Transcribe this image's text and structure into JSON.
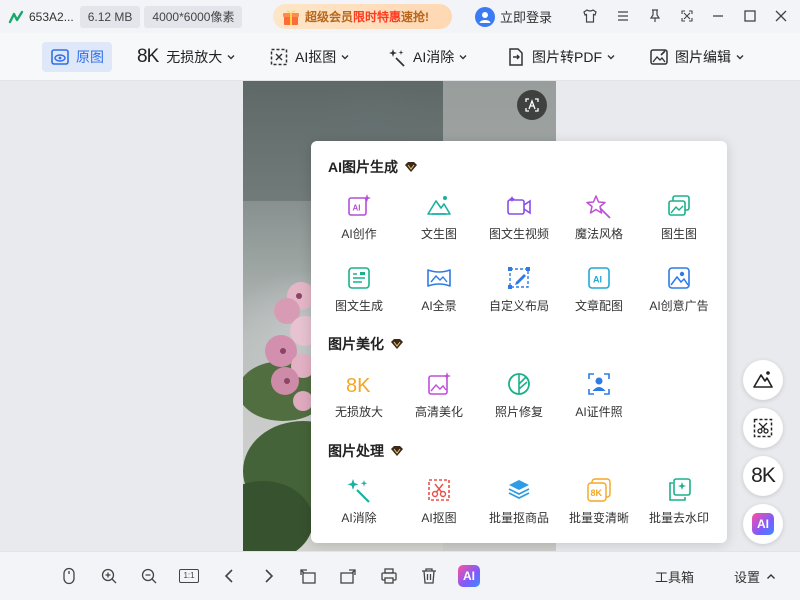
{
  "titlebar": {
    "filename": "653A2...",
    "filesize": "6.12 MB",
    "dimensions": "4000*6000像素",
    "promo": {
      "prefix": "超级会员",
      "hot": "限时特惠",
      "suffix": "速抢!"
    },
    "login_label": "立即登录"
  },
  "toolbar": {
    "original": "原图",
    "upscale_badge": "8K",
    "upscale": "无损放大",
    "cutout": "AI抠图",
    "erase": "AI消除",
    "to_pdf": "图片转PDF",
    "edit": "图片编辑"
  },
  "popup": {
    "sections": [
      {
        "title": "AI图片生成",
        "tools": [
          {
            "label": "AI创作",
            "icon": "ai-create-icon",
            "color": "#b44fd8"
          },
          {
            "label": "文生图",
            "icon": "text-to-image-icon",
            "color": "#1cb0a0"
          },
          {
            "label": "图文生视频",
            "icon": "video-icon",
            "color": "#8a4de8"
          },
          {
            "label": "魔法风格",
            "icon": "magic-icon",
            "color": "#c04fd8"
          },
          {
            "label": "图生图",
            "icon": "image-to-image-icon",
            "color": "#1cb08a"
          },
          {
            "label": "图文生成",
            "icon": "doc-gen-icon",
            "color": "#1cb08a"
          },
          {
            "label": "AI全景",
            "icon": "panorama-icon",
            "color": "#2e7be6"
          },
          {
            "label": "自定义布局",
            "icon": "layout-icon",
            "color": "#2e7be6"
          },
          {
            "label": "文章配图",
            "icon": "article-image-icon",
            "color": "#21a9d6"
          },
          {
            "label": "AI创意广告",
            "icon": "ad-icon",
            "color": "#2e7be6"
          }
        ]
      },
      {
        "title": "图片美化",
        "tools": [
          {
            "label": "无损放大",
            "icon": "8k-icon",
            "color": "#f5a623"
          },
          {
            "label": "高清美化",
            "icon": "enhance-icon",
            "color": "#c04fd8"
          },
          {
            "label": "照片修复",
            "icon": "repair-icon",
            "color": "#1cb08a"
          },
          {
            "label": "AI证件照",
            "icon": "id-photo-icon",
            "color": "#2e7be6"
          }
        ]
      },
      {
        "title": "图片处理",
        "tools": [
          {
            "label": "AI消除",
            "icon": "erase-icon",
            "color": "#1cb0a0"
          },
          {
            "label": "AI抠图",
            "icon": "cutout-icon",
            "color": "#e8504a"
          },
          {
            "label": "批量抠商品",
            "icon": "batch-cutout-icon",
            "color": "#2e9be6"
          },
          {
            "label": "批量变清晰",
            "icon": "batch-8k-icon",
            "color": "#f5a623"
          },
          {
            "label": "批量去水印",
            "icon": "watermark-icon",
            "color": "#1cb08a"
          }
        ]
      }
    ]
  },
  "floating": {
    "k8_label": "8K",
    "ai_label": "AI"
  },
  "bottombar": {
    "fit_label": "1:1",
    "ai_label": "AI",
    "toolbox": "工具箱",
    "settings": "设置"
  }
}
